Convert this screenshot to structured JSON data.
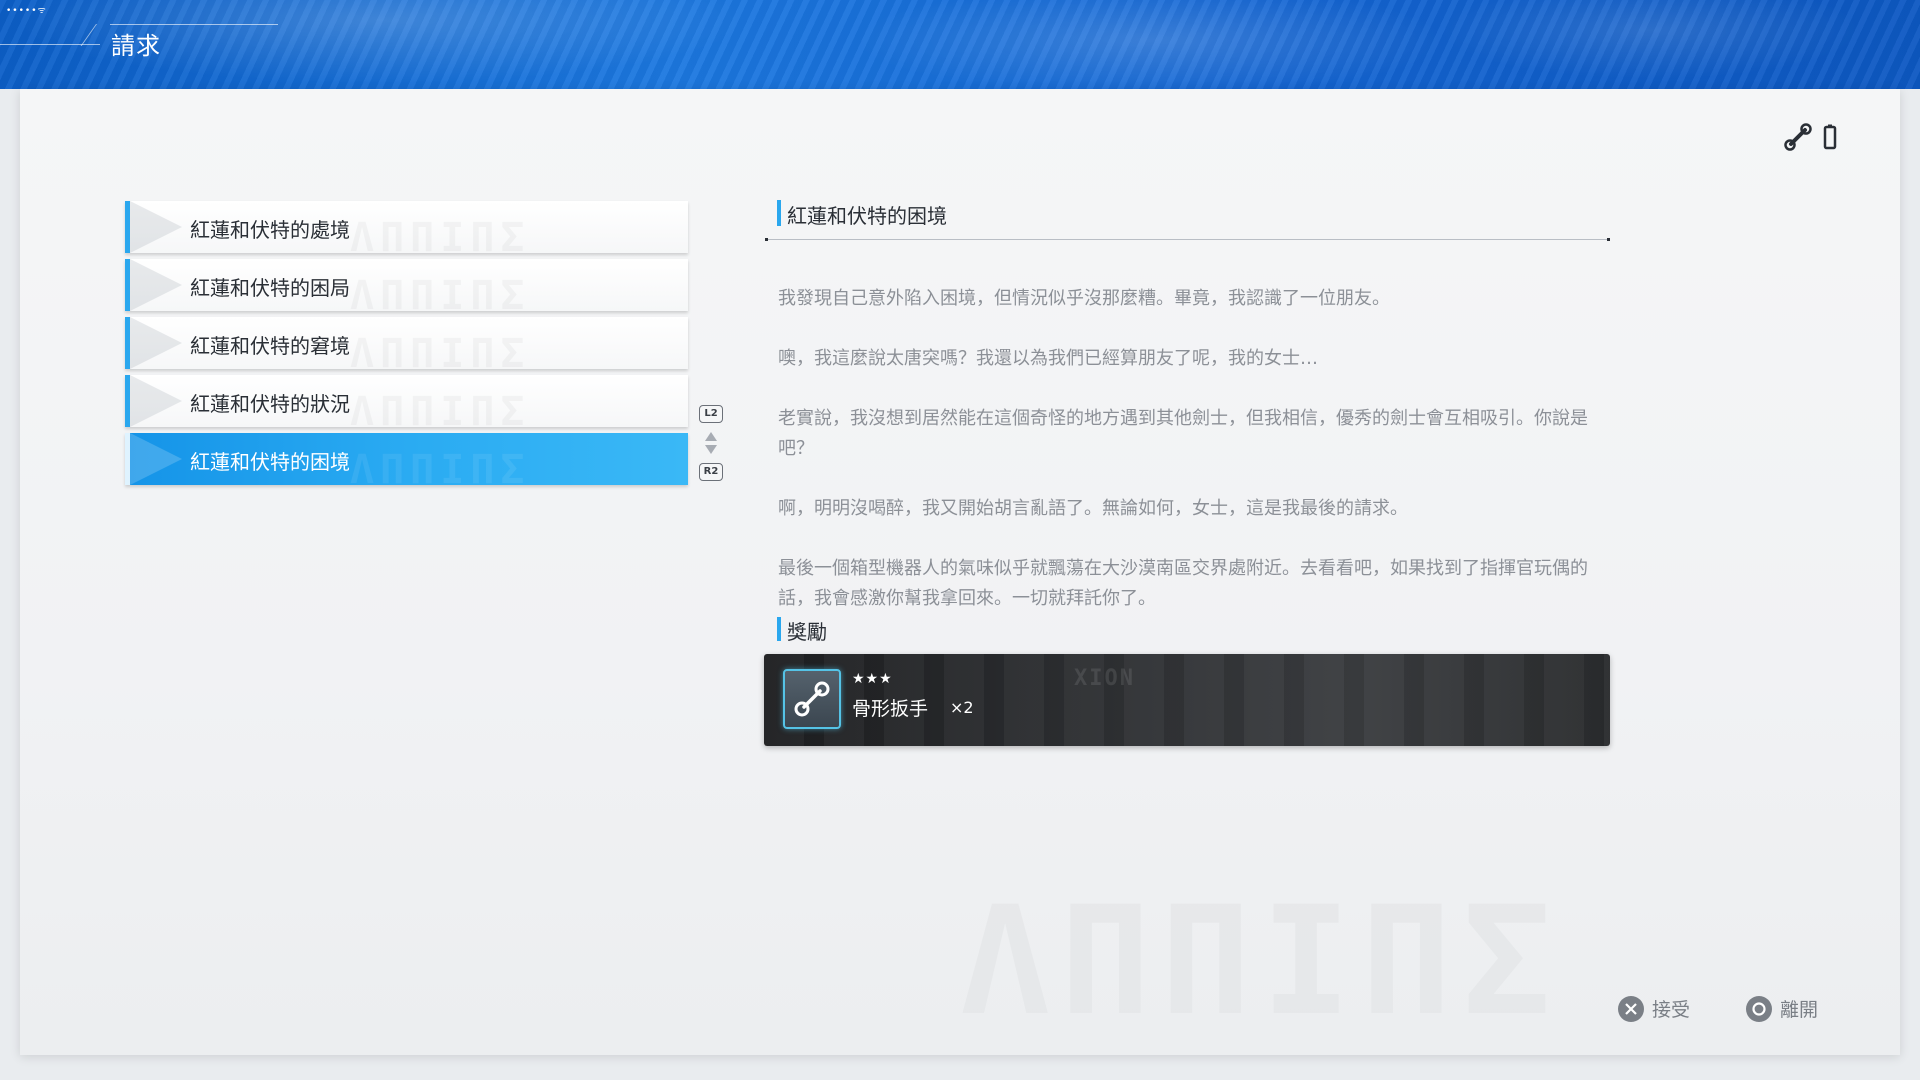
{
  "header": {
    "title": "請求",
    "signal": "•••••ᯤ"
  },
  "top_icons": [
    "wrench-icon",
    "battery-icon"
  ],
  "quest_list": {
    "items": [
      {
        "label": "紅蓮和伏特的處境",
        "selected": false
      },
      {
        "label": "紅蓮和伏特的困局",
        "selected": false
      },
      {
        "label": "紅蓮和伏特的窘境",
        "selected": false
      },
      {
        "label": "紅蓮和伏特的狀況",
        "selected": false
      },
      {
        "label": "紅蓮和伏特的困境",
        "selected": true
      }
    ],
    "decoration_text": "ΛΠΠΙΠΣ",
    "scroll_up_button": "L2",
    "scroll_down_button": "R2"
  },
  "detail": {
    "title": "紅蓮和伏特的困境",
    "paragraphs": [
      "我發現自己意外陷入困境，但情況似乎沒那麼糟。畢竟，我認識了一位朋友。",
      "噢，我這麼說太唐突嗎？我還以為我們已經算朋友了呢，我的女士…",
      "老實說，我沒想到居然能在這個奇怪的地方遇到其他劍士，但我相信，優秀的劍士會互相吸引。你說是吧？",
      "啊，明明沒喝醉，我又開始胡言亂語了。無論如何，女士，這是我最後的請求。",
      "最後一個箱型機器人的氣味似乎就飄蕩在大沙漠南區交界處附近。去看看吧，如果找到了指揮官玩偶的話，我會感激你幫我拿回來。一切就拜託你了。"
    ]
  },
  "reward": {
    "title": "獎勵",
    "card_decoration": "XION",
    "item": {
      "stars": "★★★",
      "name": "骨形扳手",
      "quantity": "×2",
      "icon": "bone-wrench-icon",
      "accent_color": "#55c3e6"
    }
  },
  "prompts": {
    "accept": {
      "button": "cross-button-icon",
      "label": "接受"
    },
    "leave": {
      "button": "circle-button-icon",
      "label": "離開"
    }
  },
  "colors": {
    "accent": "#2aa7ee",
    "header_blue": "#1466d4"
  }
}
